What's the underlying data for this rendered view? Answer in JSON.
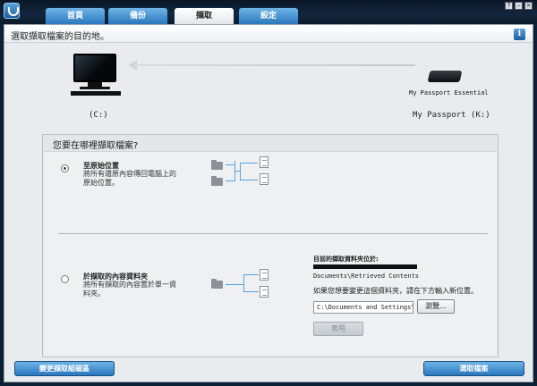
{
  "tabs": [
    {
      "label": "首頁"
    },
    {
      "label": "備份"
    },
    {
      "label": "擷取"
    },
    {
      "label": "設定"
    }
  ],
  "window_controls": {
    "help": "?",
    "minimize": "–",
    "close": "×"
  },
  "header": {
    "text": "選取擷取檔案的目的地。",
    "info_label": "i"
  },
  "devices": {
    "source_label": "My Passport Essential",
    "source_drive": "My Passport (K:)",
    "target_drive": "(C:)"
  },
  "question": {
    "title": "您要在哪裡擷取檔案?",
    "option1": {
      "title": "至原始位置",
      "desc": "將所有還原內容傳回電腦上的原始位置。",
      "selected": true
    },
    "option2": {
      "title": "於擷取的內容資料夾",
      "desc": "將所有擷取的內容置於單一資料夾。",
      "selected": false
    }
  },
  "current_folder": {
    "title": "目前的擷取資料夾位於:",
    "path_tail": "Documents\\Retrieved Contents",
    "hint": "如果您想要變更這個資料夾，請在下方輸入新位置。",
    "input_value": "C:\\Documents and Settings\\Bya",
    "browse_label": "瀏覽...",
    "apply_label": "套用"
  },
  "footer": {
    "left_button": "變更擷取組磁區",
    "right_button": "選取檔案"
  },
  "colors": {
    "tab_blue": "#2a77bd",
    "accent": "#5aa2dc",
    "background": "#0c1f33"
  }
}
